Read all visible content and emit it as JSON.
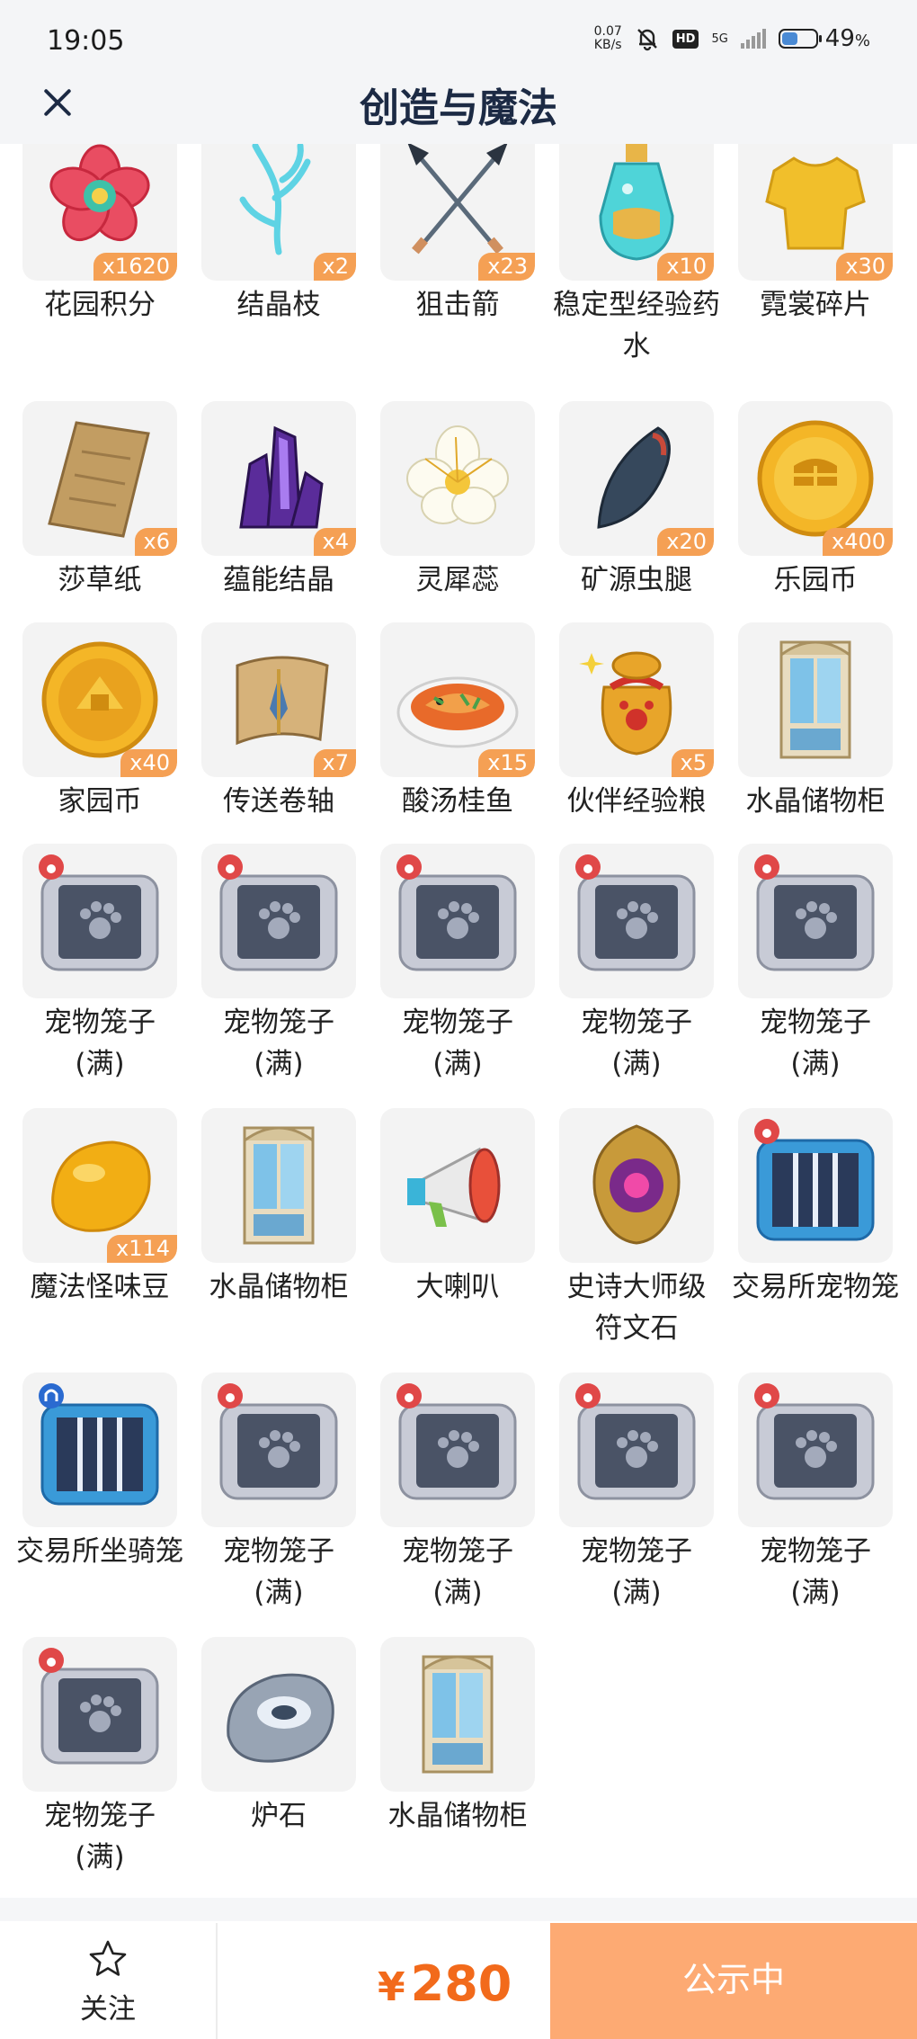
{
  "status_bar": {
    "time": "19:05",
    "net_speed_value": "0.07",
    "net_speed_unit": "KB/s",
    "hd": "HD",
    "network": "5G",
    "battery": "49",
    "battery_unit": "%"
  },
  "header": {
    "title": "创造与魔法"
  },
  "items": [
    {
      "label": "花园积分",
      "qty": "x1620",
      "icon": "flower-icon"
    },
    {
      "label": "结晶枝",
      "qty": "x2",
      "icon": "crystal-branch-icon"
    },
    {
      "label": "狙击箭",
      "qty": "x23",
      "icon": "arrows-icon"
    },
    {
      "label": "稳定型经验药水",
      "qty": "x10",
      "icon": "potion-icon"
    },
    {
      "label": "霓裳碎片",
      "qty": "x30",
      "icon": "shirt-icon"
    },
    {
      "label": "莎草纸",
      "qty": "x6",
      "icon": "papyrus-icon"
    },
    {
      "label": "蕴能结晶",
      "qty": "x4",
      "icon": "purple-crystal-icon"
    },
    {
      "label": "灵犀蕊",
      "qty": "",
      "icon": "white-flower-icon"
    },
    {
      "label": "矿源虫腿",
      "qty": "x20",
      "icon": "bug-leg-icon"
    },
    {
      "label": "乐园币",
      "qty": "x400",
      "icon": "gold-coin-icon"
    },
    {
      "label": "家园币",
      "qty": "x40",
      "icon": "home-coin-icon"
    },
    {
      "label": "传送卷轴",
      "qty": "x7",
      "icon": "scroll-icon"
    },
    {
      "label": "酸汤桂鱼",
      "qty": "x15",
      "icon": "fish-dish-icon"
    },
    {
      "label": "伙伴经验粮",
      "qty": "x5",
      "icon": "food-bag-icon"
    },
    {
      "label": "水晶储物柜",
      "qty": "",
      "icon": "crystal-cabinet-icon"
    },
    {
      "label": "宠物笼子(满)",
      "qty": "",
      "icon": "pet-cage-icon"
    },
    {
      "label": "宠物笼子(满)",
      "qty": "",
      "icon": "pet-cage-icon"
    },
    {
      "label": "宠物笼子(满)",
      "qty": "",
      "icon": "pet-cage-icon"
    },
    {
      "label": "宠物笼子(满)",
      "qty": "",
      "icon": "pet-cage-icon"
    },
    {
      "label": "宠物笼子(满)",
      "qty": "",
      "icon": "pet-cage-icon"
    },
    {
      "label": "魔法怪味豆",
      "qty": "x114",
      "icon": "magic-bean-icon"
    },
    {
      "label": "水晶储物柜",
      "qty": "",
      "icon": "crystal-cabinet-icon"
    },
    {
      "label": "大喇叭",
      "qty": "",
      "icon": "megaphone-icon"
    },
    {
      "label": "史诗大师级符文石",
      "qty": "",
      "icon": "rune-stone-icon"
    },
    {
      "label": "交易所宠物笼",
      "qty": "",
      "icon": "trade-pet-cage-icon"
    },
    {
      "label": "交易所坐骑笼",
      "qty": "",
      "icon": "trade-mount-cage-icon"
    },
    {
      "label": "宠物笼子(满)",
      "qty": "",
      "icon": "pet-cage-icon"
    },
    {
      "label": "宠物笼子(满)",
      "qty": "",
      "icon": "pet-cage-icon"
    },
    {
      "label": "宠物笼子(满)",
      "qty": "",
      "icon": "pet-cage-icon"
    },
    {
      "label": "宠物笼子(满)",
      "qty": "",
      "icon": "pet-cage-icon"
    },
    {
      "label": "宠物笼子(满)",
      "qty": "",
      "icon": "pet-cage-icon"
    },
    {
      "label": "炉石",
      "qty": "",
      "icon": "hearthstone-icon"
    },
    {
      "label": "水晶储物柜",
      "qty": "",
      "icon": "crystal-cabinet-icon"
    }
  ],
  "bottom_bar": {
    "follow_label": "关注",
    "price_symbol": "¥",
    "price_value": "280",
    "status_label": "公示中"
  },
  "colors": {
    "accent": "#f26a1b",
    "badge": "#f5a054",
    "status_button": "#fdaa73",
    "title": "#1c2a44"
  }
}
